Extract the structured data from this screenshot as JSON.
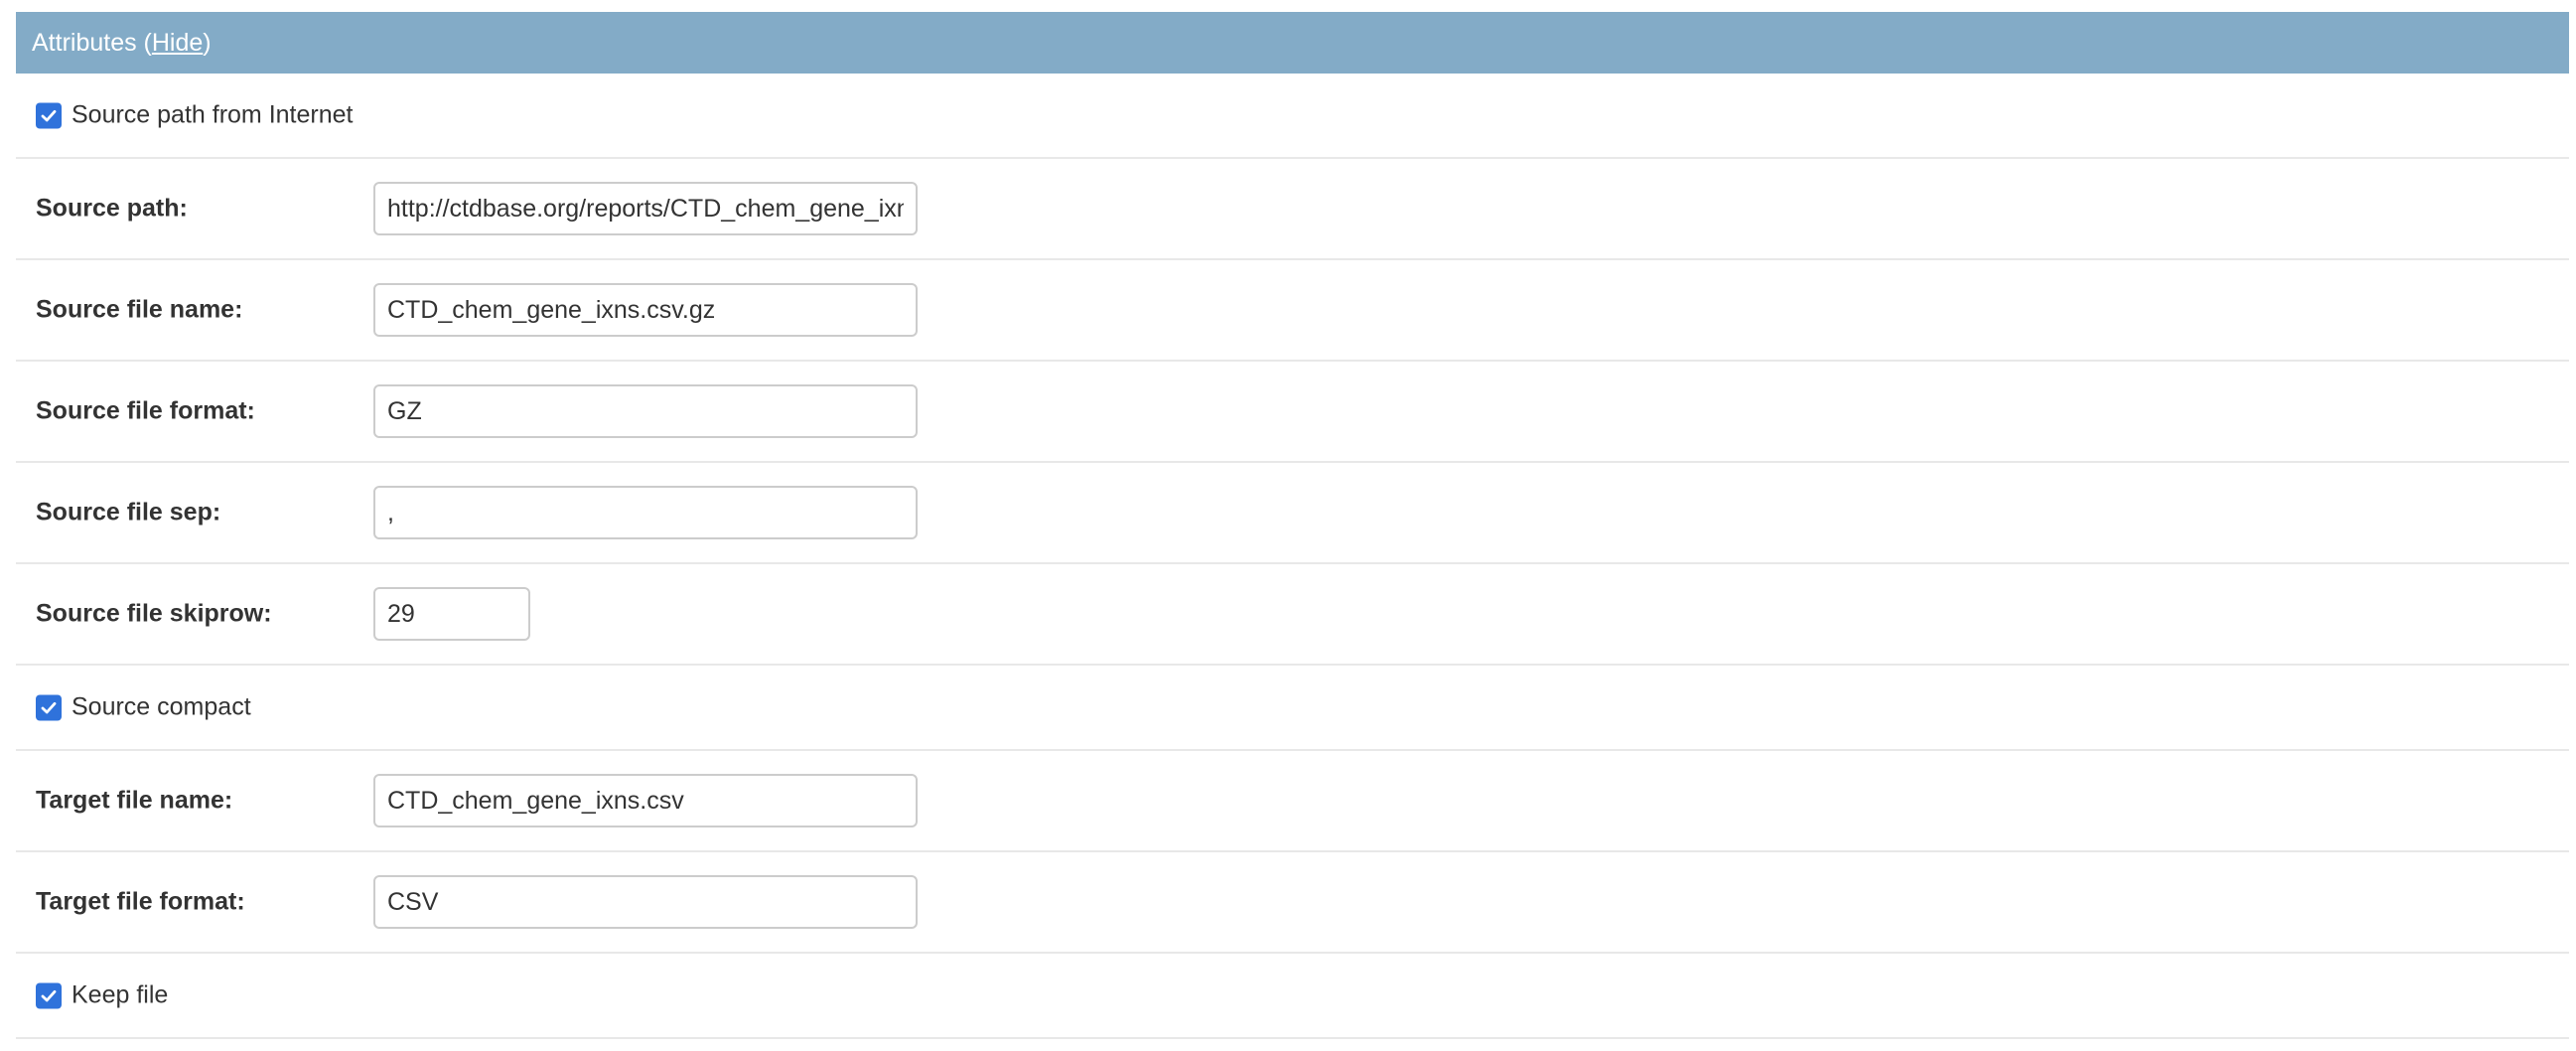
{
  "header": {
    "title": "Attributes (",
    "hide_link": "Hide",
    "title_end": ")"
  },
  "source_from_internet": {
    "checked": true,
    "label": "Source path from Internet"
  },
  "fields": {
    "source_path": {
      "label": "Source path:",
      "value": "http://ctdbase.org/reports/CTD_chem_gene_ixns.csv.gz"
    },
    "source_file_name": {
      "label": "Source file name:",
      "value": "CTD_chem_gene_ixns.csv.gz"
    },
    "source_file_format": {
      "label": "Source file format:",
      "value": "GZ"
    },
    "source_file_sep": {
      "label": "Source file sep:",
      "value": ","
    },
    "source_file_skiprow": {
      "label": "Source file skiprow:",
      "value": "29"
    },
    "target_file_name": {
      "label": "Target file name:",
      "value": "CTD_chem_gene_ixns.csv"
    },
    "target_file_format": {
      "label": "Target file format:",
      "value": "CSV"
    }
  },
  "source_compact": {
    "checked": true,
    "label": "Source compact"
  },
  "keep_file": {
    "checked": true,
    "label": "Keep file"
  },
  "colors": {
    "header_bg": "#83abc7",
    "checkbox_accent": "#2f72db"
  }
}
